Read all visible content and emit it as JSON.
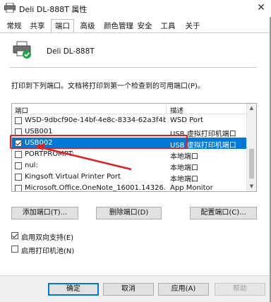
{
  "window": {
    "title": "Deli DL-888T 属性",
    "close_glyph": "✕"
  },
  "tabs": [
    {
      "label": "常规"
    },
    {
      "label": "共享"
    },
    {
      "label": "端口",
      "active": true
    },
    {
      "label": "高级"
    },
    {
      "label": "颜色管理"
    },
    {
      "label": "安全"
    },
    {
      "label": "工具"
    },
    {
      "label": "关于"
    }
  ],
  "printer": {
    "name": "Deli DL-888T",
    "icon": "printer-icon"
  },
  "ports_description": "打印到下列端口。文档将打印到第一个检查到的可用端口(P)。",
  "port_list": {
    "columns": [
      "端口",
      "描述"
    ],
    "rows": [
      {
        "port": "WSD-9dbcf90e-14bf-4e8c-8334-62a3f4b5...",
        "description": "WSD Port",
        "checked": false,
        "selected": false
      },
      {
        "port": "USB001",
        "description": "USB 虚拟打印机端口",
        "checked": false,
        "selected": false
      },
      {
        "port": "USB002",
        "description": "USB 虚拟打印机端口",
        "checked": true,
        "selected": true
      },
      {
        "port": "PORTPROMPT:",
        "description": "本地端口",
        "checked": false,
        "selected": false
      },
      {
        "port": "nul:",
        "description": "本地端口",
        "checked": false,
        "selected": false
      },
      {
        "port": "Kingsoft Virtual Printer Port",
        "description": "本地端口",
        "checked": false,
        "selected": false
      },
      {
        "port": "Microsoft.Office.OneNote_16001.14326.20...",
        "description": "App Monitor",
        "checked": false,
        "selected": false
      }
    ]
  },
  "port_buttons": {
    "add": "添加端口(T)...",
    "delete": "删除端口(D)",
    "configure": "配置端口(C)..."
  },
  "options": {
    "bidirectional": {
      "label": "启用双向支持(E)",
      "checked": true
    },
    "pooling": {
      "label": "启用打印机池(N)",
      "checked": false
    }
  },
  "dialog_buttons": {
    "ok": "确定",
    "cancel": "取消",
    "apply": "应用(A)",
    "help": "帮助"
  },
  "colors": {
    "selection": "#0078d7",
    "annotation_red": "#e02020",
    "status_green": "#1aa34a"
  }
}
